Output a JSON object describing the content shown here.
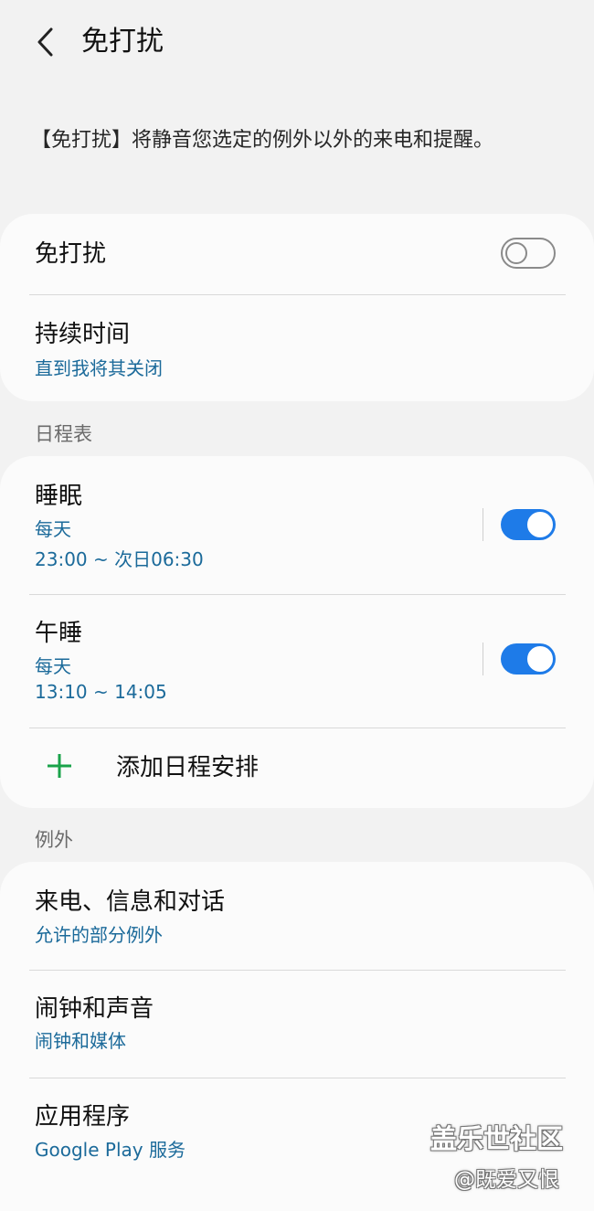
{
  "header": {
    "title": "免打扰",
    "back_icon": "chevron-left-icon"
  },
  "description": "【免打扰】将静音您选定的例外以外的来电和提醒。",
  "main_card": {
    "dnd": {
      "label": "免打扰",
      "enabled": false
    },
    "duration": {
      "label": "持续时间",
      "value": "直到我将其关闭"
    }
  },
  "schedule": {
    "section_label": "日程表",
    "items": [
      {
        "label": "睡眠",
        "days": "每天",
        "time": "23:00 ~ 次日06:30",
        "enabled": true
      },
      {
        "label": "午睡",
        "days": "每天",
        "time": "13:10 ~ 14:05",
        "enabled": true
      }
    ],
    "add_label": "添加日程安排",
    "add_icon": "plus-icon"
  },
  "exceptions": {
    "section_label": "例外",
    "items": [
      {
        "label": "来电、信息和对话",
        "value": "允许的部分例外"
      },
      {
        "label": "闹钟和声音",
        "value": "闹钟和媒体"
      },
      {
        "label": "应用程序",
        "value": "Google Play 服务"
      }
    ]
  },
  "watermark": {
    "site": "盖乐世社区",
    "user": "@既爱又恨"
  },
  "colors": {
    "accent": "#1e7be8",
    "link_text": "#1b6a9a",
    "plus_green": "#1aa34a",
    "background": "#f2f2f2",
    "card": "#fbfbfb"
  }
}
